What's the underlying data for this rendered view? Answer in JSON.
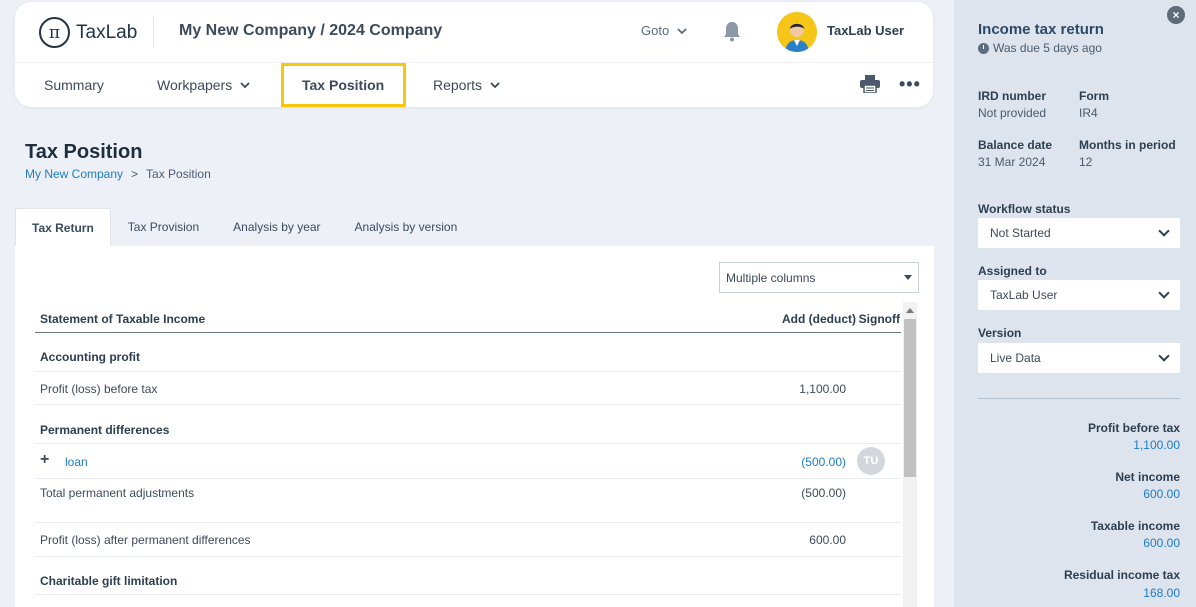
{
  "header": {
    "logo_text": "TaxLab",
    "logo_mark": "π",
    "company_title": "My New Company / 2024 Company",
    "goto_label": "Goto",
    "user_name": "TaxLab User",
    "more_label": "•••"
  },
  "nav": {
    "items": [
      {
        "label": "Summary"
      },
      {
        "label": "Workpapers"
      },
      {
        "label": "Tax Position"
      },
      {
        "label": "Reports"
      }
    ]
  },
  "page": {
    "title": "Tax Position",
    "breadcrumb": {
      "root": "My New Company",
      "sep": ">",
      "current": "Tax Position"
    }
  },
  "tabs": [
    {
      "label": "Tax Return"
    },
    {
      "label": "Tax Provision"
    },
    {
      "label": "Analysis by year"
    },
    {
      "label": "Analysis by version"
    }
  ],
  "columns_select": {
    "value": "Multiple columns"
  },
  "table": {
    "headers": {
      "col1": "Statement of Taxable Income",
      "col2": "Add (deduct)",
      "col3": "Signoff"
    },
    "rows": {
      "accounting_profit": "Accounting profit",
      "profit_before_tax_label": "Profit (loss) before tax",
      "profit_before_tax_value": "1,100.00",
      "permanent_differences": "Permanent differences",
      "loan_label": "loan",
      "loan_value": "(500.00)",
      "loan_signoff": "TU",
      "total_perm_label": "Total permanent adjustments",
      "total_perm_value": "(500.00)",
      "after_perm_label": "Profit (loss) after permanent differences",
      "after_perm_value": "600.00",
      "charitable": "Charitable gift limitation"
    }
  },
  "side": {
    "title": "Income tax return",
    "due": "Was due 5 days ago",
    "ird_label": "IRD number",
    "ird_value": "Not provided",
    "form_label": "Form",
    "form_value": "IR4",
    "balance_label": "Balance date",
    "balance_value": "31 Mar 2024",
    "months_label": "Months in period",
    "months_value": "12",
    "workflow_label": "Workflow status",
    "workflow_value": "Not Started",
    "assigned_label": "Assigned to",
    "assigned_value": "TaxLab User",
    "version_label": "Version",
    "version_value": "Live Data",
    "metrics": [
      {
        "label": "Profit before tax",
        "value": "1,100.00"
      },
      {
        "label": "Net income",
        "value": "600.00"
      },
      {
        "label": "Taxable income",
        "value": "600.00"
      },
      {
        "label": "Residual income tax",
        "value": "168.00"
      }
    ]
  }
}
